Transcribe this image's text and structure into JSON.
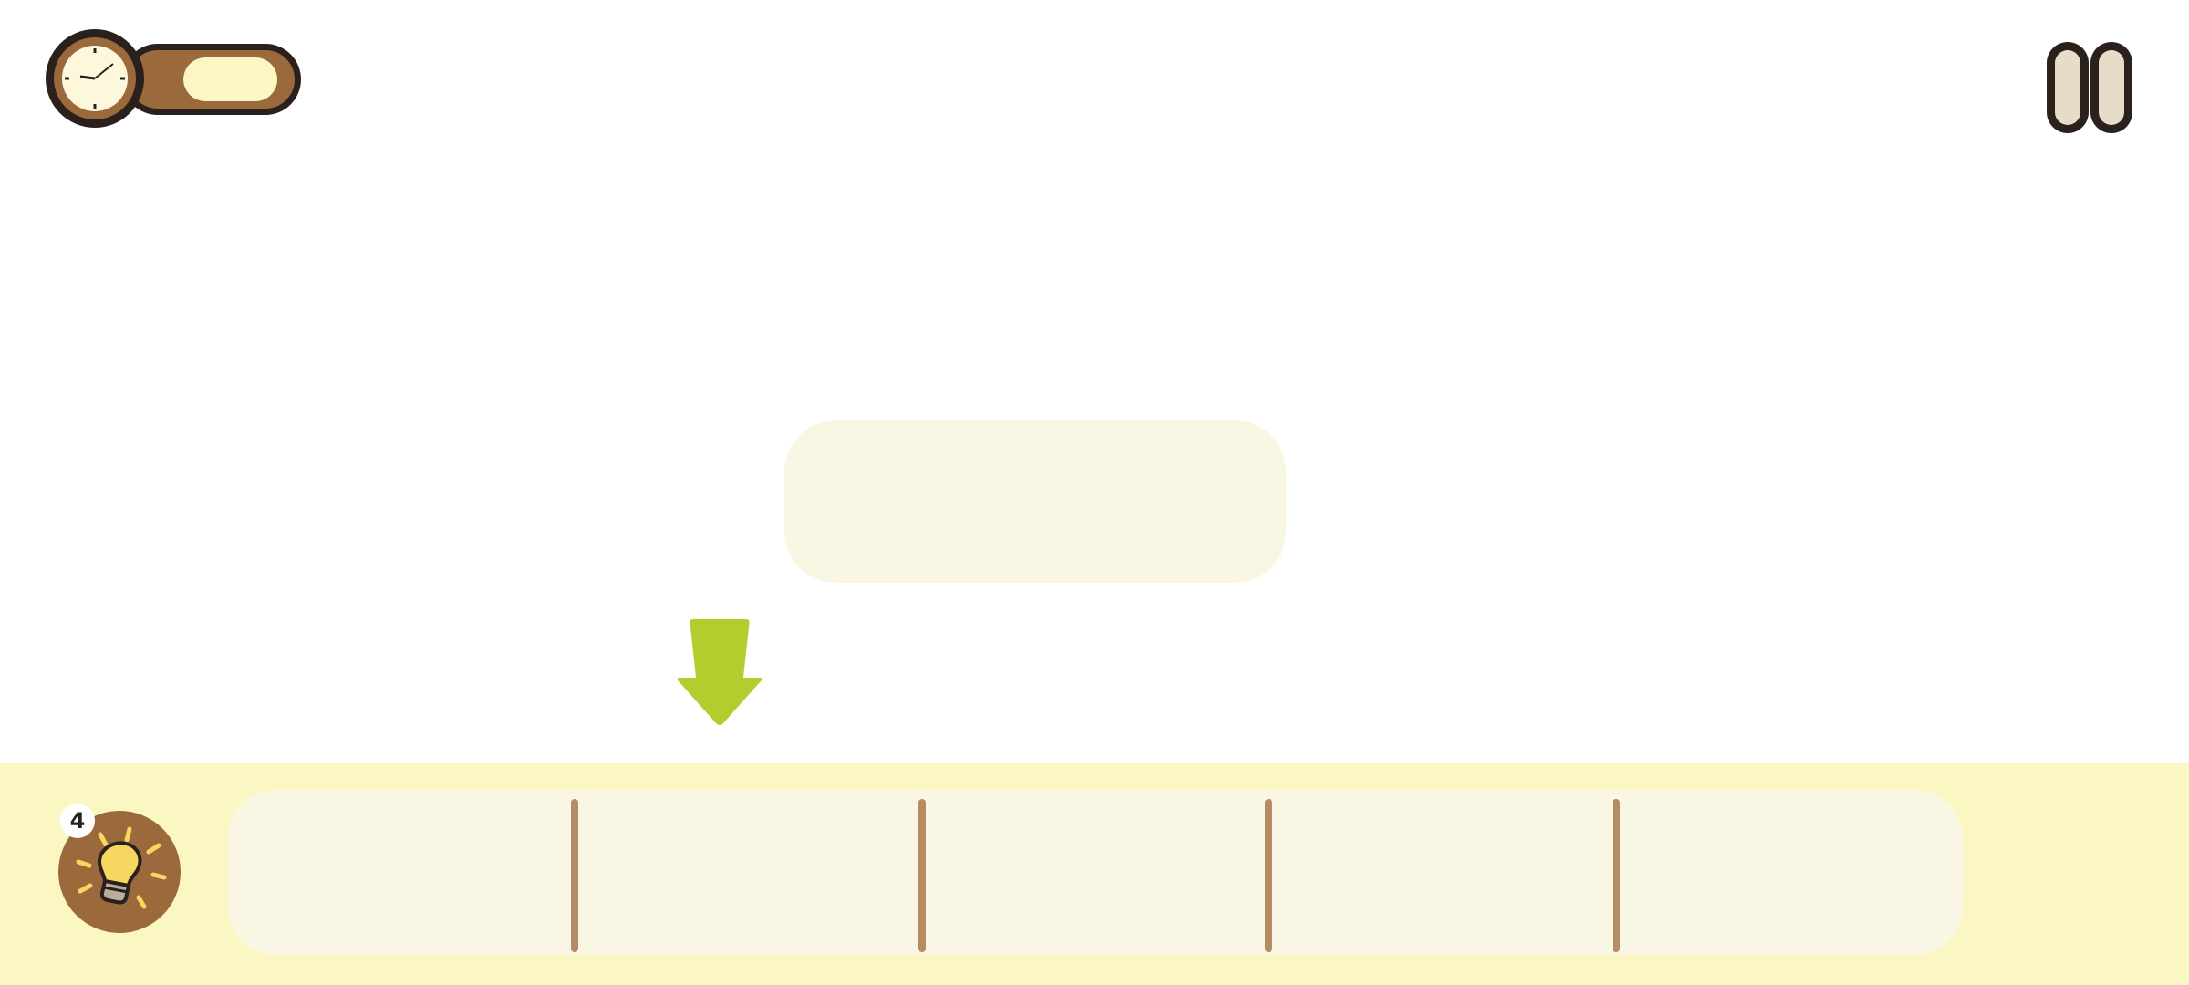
{
  "game": {
    "colors": {
      "background": "#ffffff",
      "tray": "#fbf7c2",
      "slot": "#faf6e4",
      "brown": "#9a6a3c",
      "outline": "#2a211d",
      "arrow": "#b5cc2e",
      "bulb": "#f6d860",
      "rack_divider": "#b58c64"
    }
  },
  "hud": {
    "timer": {
      "icon": "clock-icon",
      "remaining_fraction": 0.9
    },
    "pause": {
      "icon": "pause-icon"
    }
  },
  "board": {
    "answer_slot": {
      "filled": false
    },
    "hint_arrow": {
      "icon": "arrow-down-icon",
      "direction": "down"
    }
  },
  "tray": {
    "hint": {
      "icon": "lightbulb-icon",
      "count": "4"
    },
    "rack": {
      "slot_count": 5,
      "slots": [
        "",
        "",
        "",
        "",
        ""
      ]
    }
  }
}
